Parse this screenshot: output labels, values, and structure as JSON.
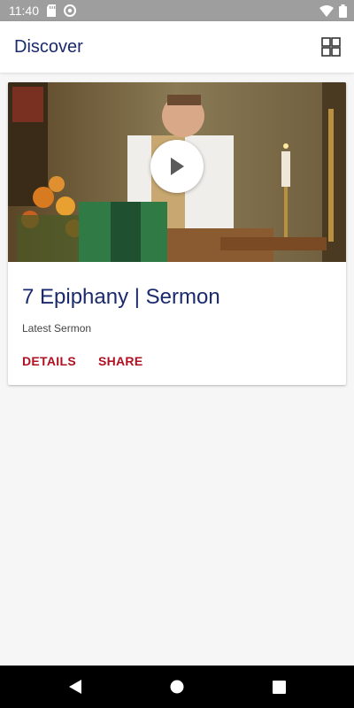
{
  "status_bar": {
    "time": "11:40",
    "icons": [
      "sd-card-icon",
      "sync-icon",
      "wifi-icon",
      "battery-icon"
    ]
  },
  "app_bar": {
    "title": "Discover",
    "grid_icon": "grid-view-icon"
  },
  "card": {
    "title": "7 Epiphany | Sermon",
    "subtitle": "Latest Sermon",
    "actions": [
      {
        "label": "DETAILS"
      },
      {
        "label": "SHARE"
      }
    ],
    "play_icon": "play-icon"
  },
  "nav_bar": {
    "icons": [
      "back-icon",
      "home-icon",
      "recents-icon"
    ]
  },
  "colors": {
    "title_blue": "#1a2a6c",
    "action_red": "#b01020",
    "status_bar_bg": "#9e9e9e",
    "nav_bar_bg": "#000000"
  }
}
